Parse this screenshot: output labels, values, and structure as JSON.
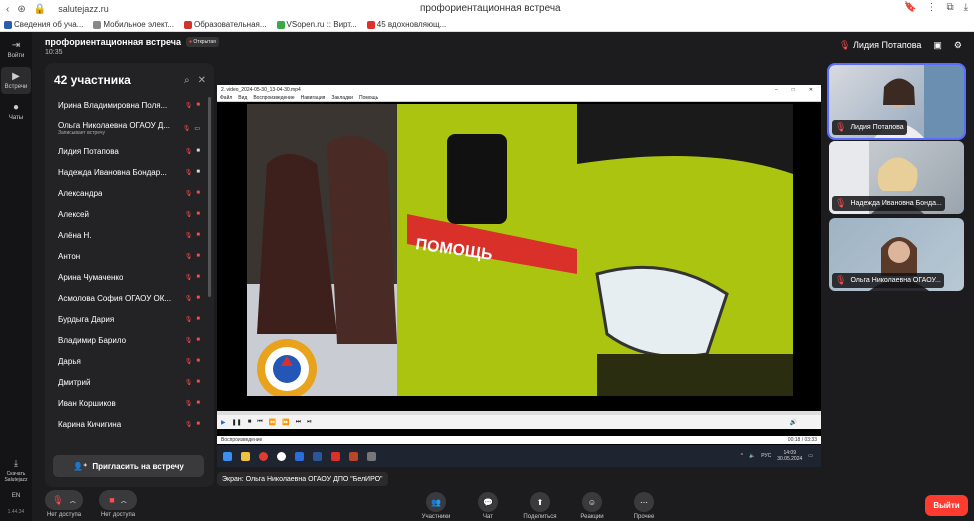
{
  "browser": {
    "url": "salutejazz.ru",
    "tab_title": "профориентационная встреча",
    "bookmarks": [
      "Сведения об уча...",
      "Мобильное элект...",
      "Образовательная...",
      "VSopen.ru :: Вирт...",
      "45 вдохновляющ..."
    ]
  },
  "rail": {
    "items": [
      {
        "label": "Войти"
      },
      {
        "label": "Встречи"
      },
      {
        "label": "Чаты"
      }
    ],
    "download_label": "Скачать Salutejazz",
    "lang": "EN",
    "version": "1.44.34"
  },
  "header": {
    "title": "профориентационная встреча",
    "badge": "Открытая",
    "time": "10:35",
    "host_name": "Лидия Потапова"
  },
  "participants": {
    "title": "42 участника",
    "invite_label": "Пригласить на встречу",
    "list": [
      {
        "name": "Ирина Владимировна Поля...",
        "sub": ""
      },
      {
        "name": "Ольга Николаевна ОГАОУ Д...",
        "sub": "Записывает встречу"
      },
      {
        "name": "Лидия Потапова",
        "sub": ""
      },
      {
        "name": "Надежда Ивановна Бондар...",
        "sub": ""
      },
      {
        "name": "Александра",
        "sub": ""
      },
      {
        "name": "Алексей",
        "sub": ""
      },
      {
        "name": "Алёна Н.",
        "sub": ""
      },
      {
        "name": "Антон",
        "sub": ""
      },
      {
        "name": "Арина Чумаченко",
        "sub": ""
      },
      {
        "name": "Асмолова София ОГАОУ ОК...",
        "sub": ""
      },
      {
        "name": "Бурдыга Дария",
        "sub": ""
      },
      {
        "name": "Владимир Барило",
        "sub": ""
      },
      {
        "name": "Дарья",
        "sub": ""
      },
      {
        "name": "Дмитрий",
        "sub": ""
      },
      {
        "name": "Иван Коршиков",
        "sub": ""
      },
      {
        "name": "Карина Кичигина",
        "sub": ""
      }
    ]
  },
  "player": {
    "window_title": "2. video_2024-05-30_13-04-30.mp4",
    "menu": [
      "Файл",
      "Вид",
      "Воспроизведение",
      "Навигация",
      "Закладки",
      "Помощь"
    ],
    "status": "Воспроизведение",
    "time": "00:18 / 03:33",
    "van_text": "ПОМОЩЬ",
    "clock_time": "14:09",
    "clock_date": "30.05.2024",
    "lang": "РУС"
  },
  "share_label": "Экран: Ольга Николаевна ОГАОУ ДПО \"БелИРО\"",
  "tiles": [
    {
      "name": "Лидия Потапова"
    },
    {
      "name": "Надежда Ивановна Бонда..."
    },
    {
      "name": "Ольга Николаевна ОГАОУ..."
    }
  ],
  "controls": {
    "mic_label": "Нет доступа",
    "cam_label": "Нет доступа",
    "buttons": [
      "Участники",
      "Чат",
      "Поделиться",
      "Реакции",
      "Прочее"
    ],
    "leave_label": "Выйти"
  },
  "colors": {
    "accent_red": "#ff3b30",
    "van_yellow": "#b4cf12",
    "panel_bg": "#232325"
  }
}
